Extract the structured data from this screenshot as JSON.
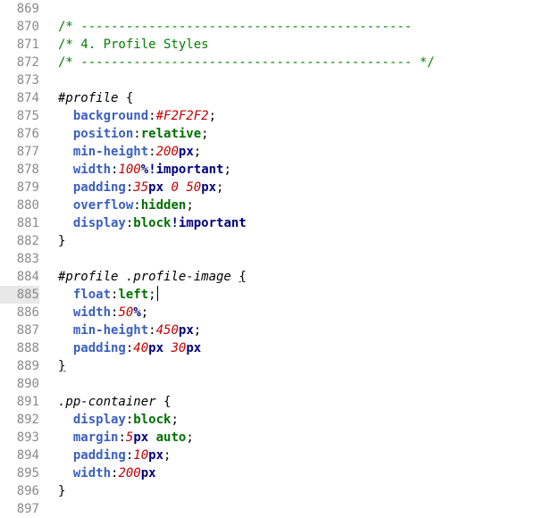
{
  "editor": {
    "current_line": 885,
    "lines": [
      {
        "n": "869",
        "parts": []
      },
      {
        "n": "870",
        "parts": [
          {
            "t": "/* --------------------------------------------",
            "c": "c-comment"
          }
        ]
      },
      {
        "n": "871",
        "parts": [
          {
            "t": "/* 4. Profile Styles",
            "c": "c-comment"
          }
        ]
      },
      {
        "n": "872",
        "parts": [
          {
            "t": "/* -------------------------------------------- */",
            "c": "c-comment"
          }
        ]
      },
      {
        "n": "873",
        "parts": []
      },
      {
        "n": "874",
        "parts": [
          {
            "t": "#profile",
            "c": "c-sel"
          },
          {
            "t": " {",
            "c": "c-punc"
          }
        ]
      },
      {
        "n": "875",
        "parts": [
          {
            "t": "  background",
            "c": "c-prop"
          },
          {
            "t": ":",
            "c": "c-punc"
          },
          {
            "t": "#F2F2F2",
            "c": "c-hex"
          },
          {
            "t": ";",
            "c": "c-punc"
          }
        ]
      },
      {
        "n": "876",
        "parts": [
          {
            "t": "  position",
            "c": "c-prop"
          },
          {
            "t": ":",
            "c": "c-punc"
          },
          {
            "t": "relative",
            "c": "c-kw"
          },
          {
            "t": ";",
            "c": "c-punc"
          }
        ]
      },
      {
        "n": "877",
        "parts": [
          {
            "t": "  min-height",
            "c": "c-prop"
          },
          {
            "t": ":",
            "c": "c-punc"
          },
          {
            "t": "200",
            "c": "c-num"
          },
          {
            "t": "px",
            "c": "c-unit"
          },
          {
            "t": ";",
            "c": "c-punc"
          }
        ]
      },
      {
        "n": "878",
        "parts": [
          {
            "t": "  width",
            "c": "c-prop"
          },
          {
            "t": ":",
            "c": "c-punc"
          },
          {
            "t": "100",
            "c": "c-num"
          },
          {
            "t": "%",
            "c": "c-unit"
          },
          {
            "t": "!important",
            "c": "c-imp"
          },
          {
            "t": ";",
            "c": "c-punc"
          }
        ]
      },
      {
        "n": "879",
        "parts": [
          {
            "t": "  padding",
            "c": "c-prop"
          },
          {
            "t": ":",
            "c": "c-punc"
          },
          {
            "t": "35",
            "c": "c-num"
          },
          {
            "t": "px",
            "c": "c-unit"
          },
          {
            "t": " ",
            "c": "c-punc"
          },
          {
            "t": "0",
            "c": "c-num"
          },
          {
            "t": " ",
            "c": "c-punc"
          },
          {
            "t": "50",
            "c": "c-num"
          },
          {
            "t": "px",
            "c": "c-unit"
          },
          {
            "t": ";",
            "c": "c-punc"
          }
        ]
      },
      {
        "n": "880",
        "parts": [
          {
            "t": "  overflow",
            "c": "c-prop"
          },
          {
            "t": ":",
            "c": "c-punc"
          },
          {
            "t": "hidden",
            "c": "c-kw"
          },
          {
            "t": ";",
            "c": "c-punc"
          }
        ]
      },
      {
        "n": "881",
        "parts": [
          {
            "t": "  display",
            "c": "c-prop"
          },
          {
            "t": ":",
            "c": "c-punc"
          },
          {
            "t": "block",
            "c": "c-kw"
          },
          {
            "t": "!important",
            "c": "c-imp"
          }
        ]
      },
      {
        "n": "882",
        "parts": [
          {
            "t": "}",
            "c": "c-punc"
          }
        ]
      },
      {
        "n": "883",
        "parts": []
      },
      {
        "n": "884",
        "parts": [
          {
            "t": "#profile .profile-image",
            "c": "c-sel"
          },
          {
            "t": " ",
            "c": "c-punc"
          },
          {
            "t": "{",
            "c": "c-punc brace-hl"
          }
        ]
      },
      {
        "n": "885",
        "parts": [
          {
            "t": "  float",
            "c": "c-prop"
          },
          {
            "t": ":",
            "c": "c-punc"
          },
          {
            "t": "left",
            "c": "c-kw"
          },
          {
            "t": ";",
            "c": "c-punc"
          }
        ],
        "caret": true
      },
      {
        "n": "886",
        "parts": [
          {
            "t": "  width",
            "c": "c-prop"
          },
          {
            "t": ":",
            "c": "c-punc"
          },
          {
            "t": "50",
            "c": "c-num"
          },
          {
            "t": "%",
            "c": "c-unit"
          },
          {
            "t": ";",
            "c": "c-punc"
          }
        ]
      },
      {
        "n": "887",
        "parts": [
          {
            "t": "  min-height",
            "c": "c-prop"
          },
          {
            "t": ":",
            "c": "c-punc"
          },
          {
            "t": "450",
            "c": "c-num"
          },
          {
            "t": "px",
            "c": "c-unit"
          },
          {
            "t": ";",
            "c": "c-punc"
          }
        ]
      },
      {
        "n": "888",
        "parts": [
          {
            "t": "  padding",
            "c": "c-prop"
          },
          {
            "t": ":",
            "c": "c-punc"
          },
          {
            "t": "40",
            "c": "c-num"
          },
          {
            "t": "px",
            "c": "c-unit"
          },
          {
            "t": " ",
            "c": "c-punc"
          },
          {
            "t": "30",
            "c": "c-num"
          },
          {
            "t": "px",
            "c": "c-unit"
          }
        ]
      },
      {
        "n": "889",
        "parts": [
          {
            "t": "}",
            "c": "c-punc brace-hl"
          }
        ]
      },
      {
        "n": "890",
        "parts": []
      },
      {
        "n": "891",
        "parts": [
          {
            "t": ".pp-container",
            "c": "c-sel"
          },
          {
            "t": " {",
            "c": "c-punc"
          }
        ]
      },
      {
        "n": "892",
        "parts": [
          {
            "t": "  display",
            "c": "c-prop"
          },
          {
            "t": ":",
            "c": "c-punc"
          },
          {
            "t": "block",
            "c": "c-kw"
          },
          {
            "t": ";",
            "c": "c-punc"
          }
        ]
      },
      {
        "n": "893",
        "parts": [
          {
            "t": "  margin",
            "c": "c-prop"
          },
          {
            "t": ":",
            "c": "c-punc"
          },
          {
            "t": "5",
            "c": "c-num"
          },
          {
            "t": "px",
            "c": "c-unit"
          },
          {
            "t": " ",
            "c": "c-punc"
          },
          {
            "t": "auto",
            "c": "c-kw"
          },
          {
            "t": ";",
            "c": "c-punc"
          }
        ]
      },
      {
        "n": "894",
        "parts": [
          {
            "t": "  padding",
            "c": "c-prop"
          },
          {
            "t": ":",
            "c": "c-punc"
          },
          {
            "t": "10",
            "c": "c-num"
          },
          {
            "t": "px",
            "c": "c-unit"
          },
          {
            "t": ";",
            "c": "c-punc"
          }
        ]
      },
      {
        "n": "895",
        "parts": [
          {
            "t": "  width",
            "c": "c-prop"
          },
          {
            "t": ":",
            "c": "c-punc"
          },
          {
            "t": "200",
            "c": "c-num"
          },
          {
            "t": "px",
            "c": "c-unit"
          }
        ]
      },
      {
        "n": "896",
        "parts": [
          {
            "t": "}",
            "c": "c-punc"
          }
        ]
      },
      {
        "n": "897",
        "parts": []
      }
    ]
  }
}
